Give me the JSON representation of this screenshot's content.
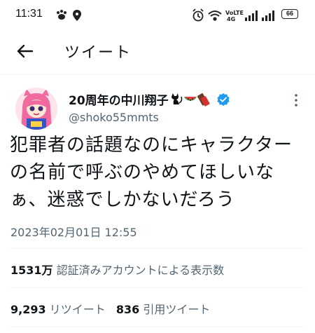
{
  "status_bar": {
    "time": "11:31",
    "battery": "66"
  },
  "header": {
    "title": "ツイート"
  },
  "author": {
    "display_name": "20周年の中川翔子",
    "handle": "@shoko55mmts"
  },
  "tweet": {
    "text_lines": [
      "犯罪者の話題なのにキャラクター",
      "の名前で呼ぶのやめてほしいな",
      "ぁ、迷惑でしかないだろう"
    ],
    "timestamp": "2023年02月01日 12:55"
  },
  "stats": {
    "views_count": "1531万",
    "views_label": "認証済みアカウントによる表示数",
    "retweets_count": "9,293",
    "retweets_label": "リツイート",
    "quotes_count": "836",
    "quotes_label": "引用ツイート"
  },
  "colors": {
    "text": "#0f1419",
    "secondary": "#536471",
    "verified": "#1d9bf0",
    "divider": "#eff3f4"
  }
}
